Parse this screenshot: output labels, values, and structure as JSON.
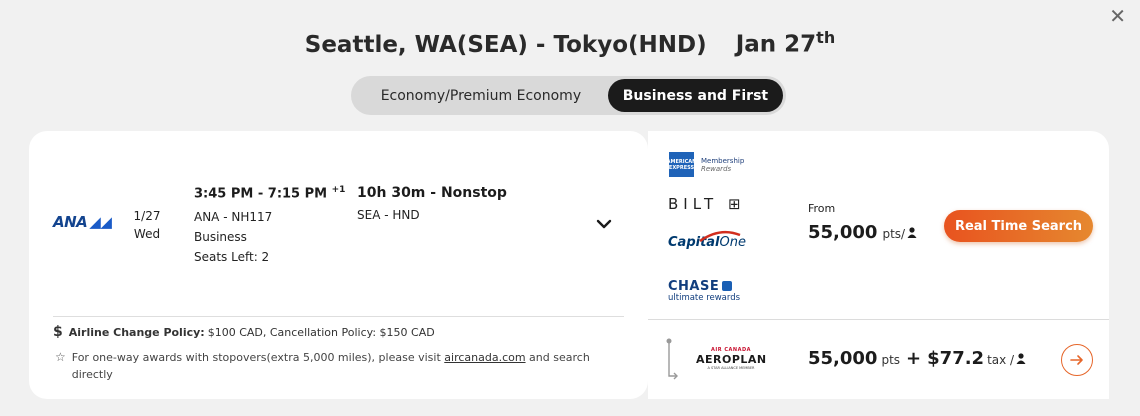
{
  "header": {
    "route": "Seattle, WA(SEA) - Tokyo(HND)",
    "date_main": "Jan 27",
    "date_suffix": "th",
    "close_icon": "close-icon"
  },
  "cabin_toggle": {
    "options": [
      "Economy/Premium Economy",
      "Business and First"
    ],
    "selected": "Business and First"
  },
  "flight": {
    "airline": "ANA",
    "date": "1/27",
    "weekday": "Wed",
    "time_range": "3:45 PM - 7:15 PM",
    "day_offset": "+1",
    "flight_number": "ANA - NH117",
    "cabin": "Business",
    "seats_left": "Seats Left: 2",
    "duration": "10h 30m - Nonstop",
    "segment": "SEA - HND"
  },
  "policy": {
    "label": "Airline Change Policy:",
    "text": "$100 CAD, Cancellation Policy: $150 CAD"
  },
  "note": {
    "before_link": "For one-way awards with stopovers(extra 5,000 miles), please visit ",
    "link": "aircanada.com",
    "after_link": " and search directly"
  },
  "transfer_partners": {
    "amex_box": "AMERICAN EXPRESS",
    "amex_line1": "Membership",
    "amex_line2": "Rewards",
    "bilt": "BILT",
    "capital_one_a": "Capital",
    "capital_one_b": "One",
    "chase": "CHASE",
    "chase_sub": "ultimate rewards"
  },
  "price_top": {
    "from_label": "From",
    "points": "55,000",
    "unit": "pts/",
    "button": "Real Time Search"
  },
  "price_bottom": {
    "program_top": "AIR CANADA",
    "program": "AEROPLAN",
    "program_sub": "A STAR ALLIANCE MEMBER",
    "points": "55,000",
    "unit": "pts",
    "plus": "+",
    "tax": "$77.2",
    "tax_label": "tax /"
  },
  "colors": {
    "accent": "#e8531f",
    "dark": "#1b1b1b",
    "ana_blue": "#13448f"
  }
}
